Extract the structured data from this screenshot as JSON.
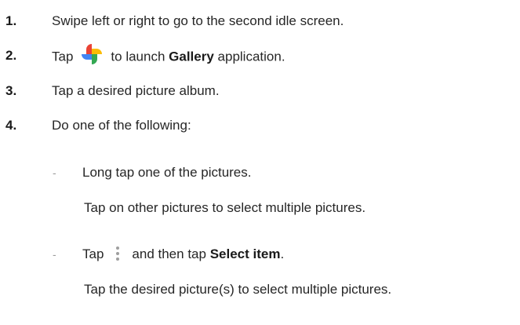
{
  "steps": [
    {
      "number": "1.",
      "text": "Swipe left or right to go to the second idle screen."
    },
    {
      "number": "2.",
      "before_icon": "Tap",
      "icon": "gallery-pinwheel-icon",
      "after_icon_1": "to launch ",
      "bold": "Gallery",
      "after_icon_2": " application."
    },
    {
      "number": "3.",
      "text": "Tap a desired picture album."
    },
    {
      "number": "4.",
      "text": "Do one of the following:"
    }
  ],
  "options": [
    {
      "marker": "-",
      "text": "Long tap one of the pictures.",
      "note": "Tap on other pictures to select multiple pictures."
    },
    {
      "marker": "-",
      "before_icon": "Tap",
      "icon": "more-options-vertical-dots-icon",
      "after_icon": "and then tap ",
      "bold": "Select item",
      "after_bold": ".",
      "note": "Tap the desired picture(s) to select multiple pictures."
    }
  ],
  "colors": {
    "text": "#262626",
    "pinwheel_blue": "#4285f4",
    "pinwheel_red": "#ea4335",
    "pinwheel_yellow": "#fbbc05",
    "pinwheel_green": "#34a853",
    "dots": "#9e9e9e"
  }
}
